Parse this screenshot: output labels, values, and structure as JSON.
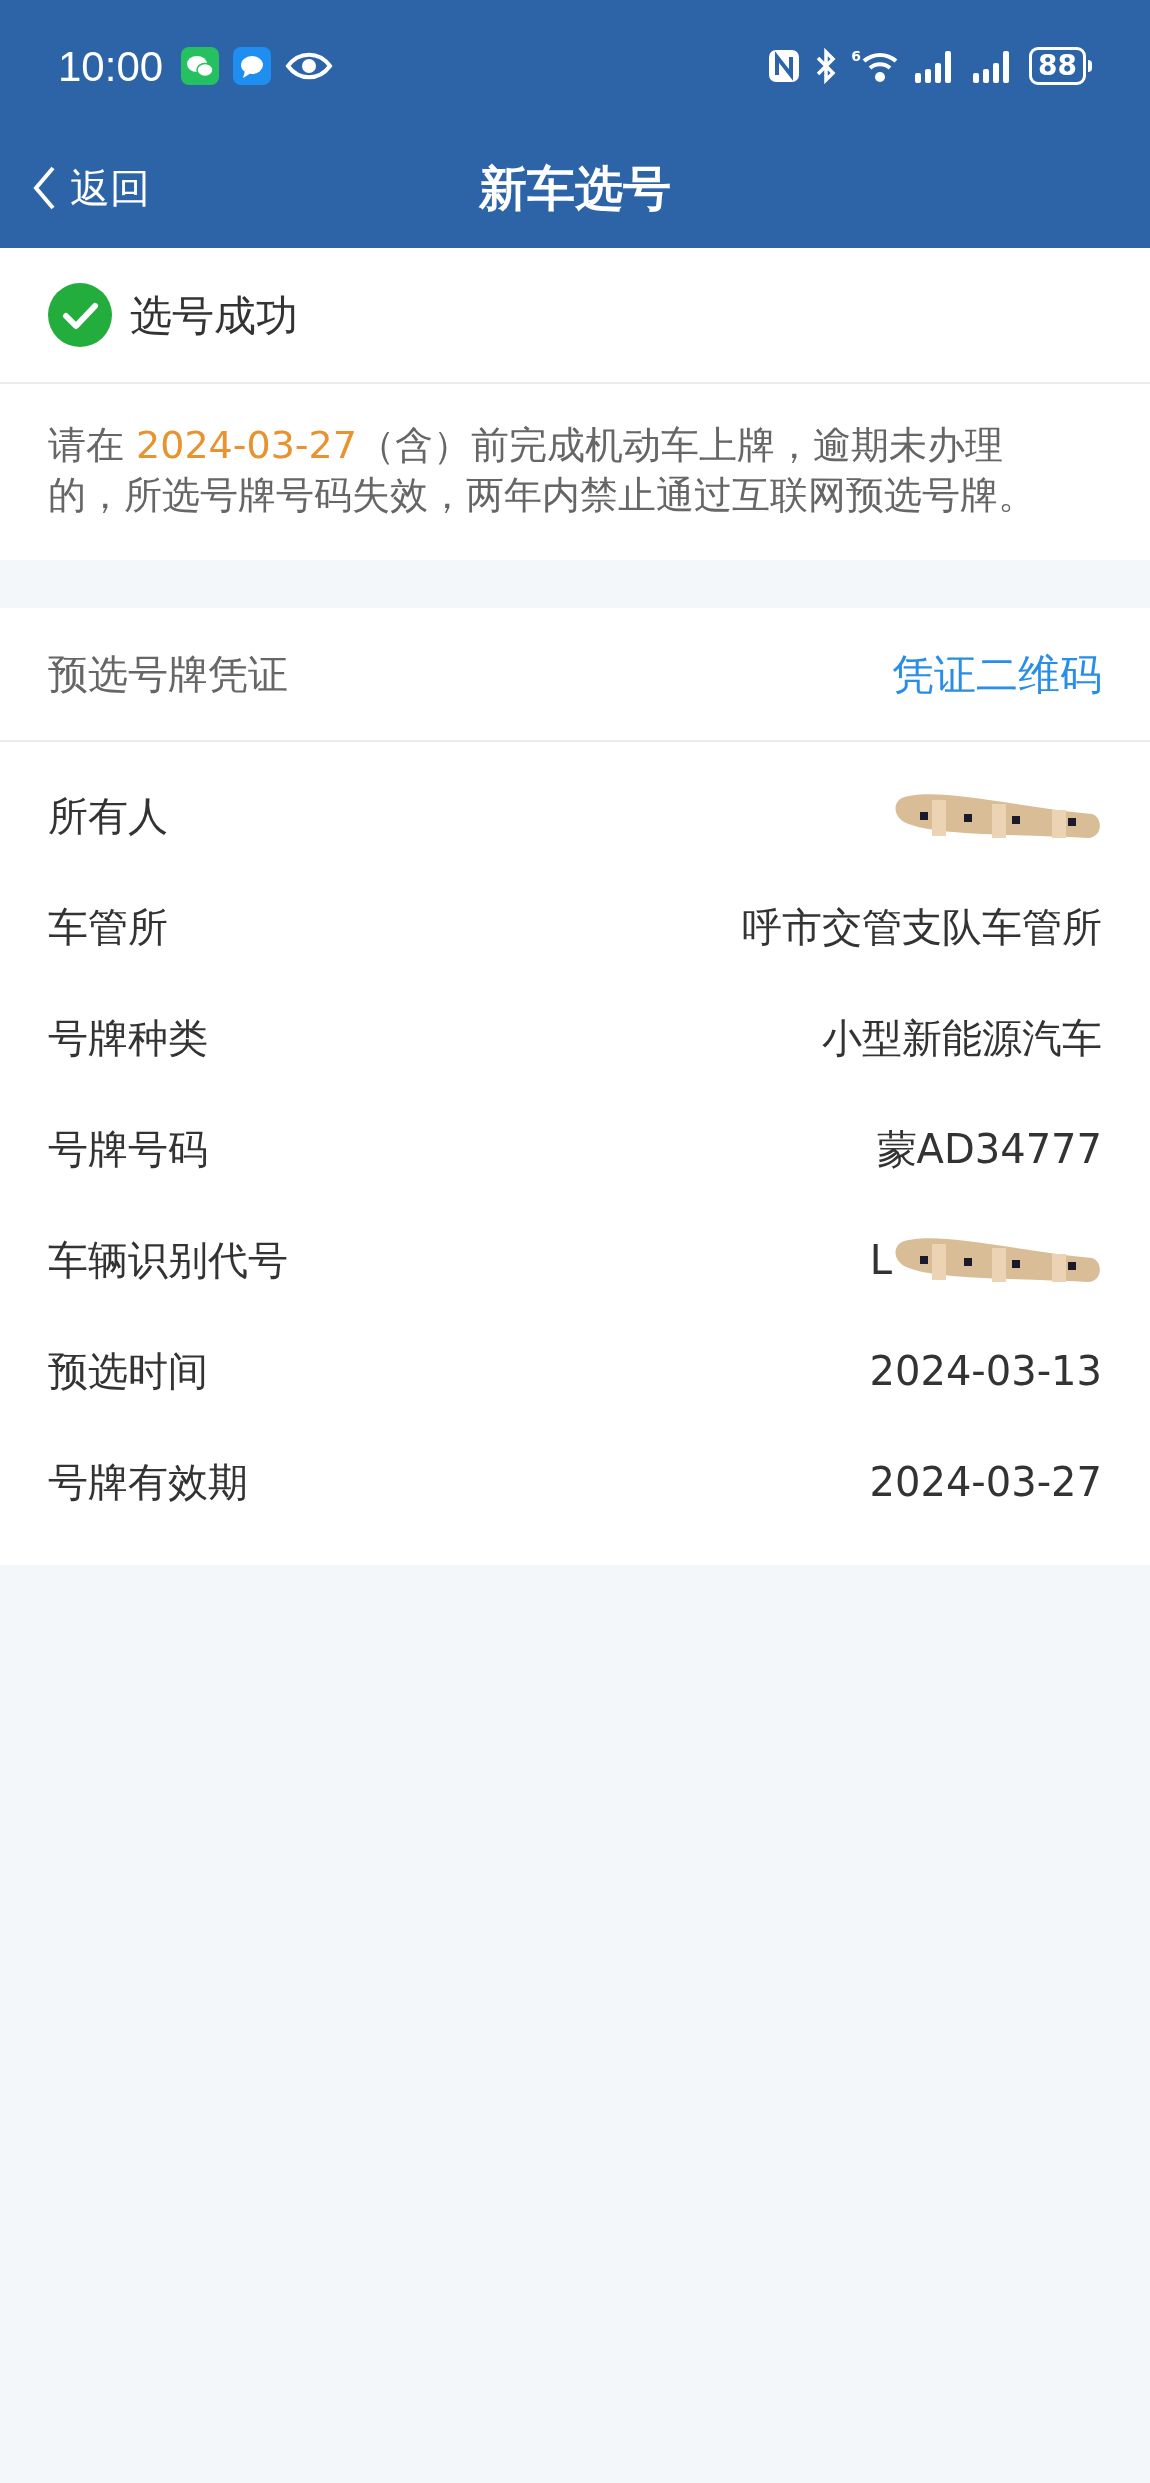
{
  "status_bar": {
    "time": "10:00",
    "battery": "88",
    "wifi_badge": "6"
  },
  "nav": {
    "back": "返回",
    "title": "新车选号"
  },
  "result": {
    "text": "选号成功"
  },
  "notice": "请在 **2024-03-27**（含）前完成机动车上牌，逾期未办理的，所选号牌号码失效，两年内禁止通过互联网预选号牌。",
  "voucher": {
    "title": "预选号牌凭证",
    "link": "凭证二维码"
  },
  "rows": [
    {
      "label": "所有人",
      "redacted": true
    },
    {
      "label": "车管所",
      "value": "呼市交管支队车管所",
      "redacted": false
    },
    {
      "label": "号牌种类",
      "value": "小型新能源汽车",
      "redacted": false
    },
    {
      "label": "号牌号码",
      "value": "蒙AD34777",
      "redacted": false
    },
    {
      "label": "车辆识别代号",
      "value": "L",
      "redacted": true
    },
    {
      "label": "预选时间",
      "value": "2024-03-13",
      "redacted": false
    },
    {
      "label": "号牌有效期",
      "value": "2024-03-27",
      "redacted": false
    }
  ]
}
